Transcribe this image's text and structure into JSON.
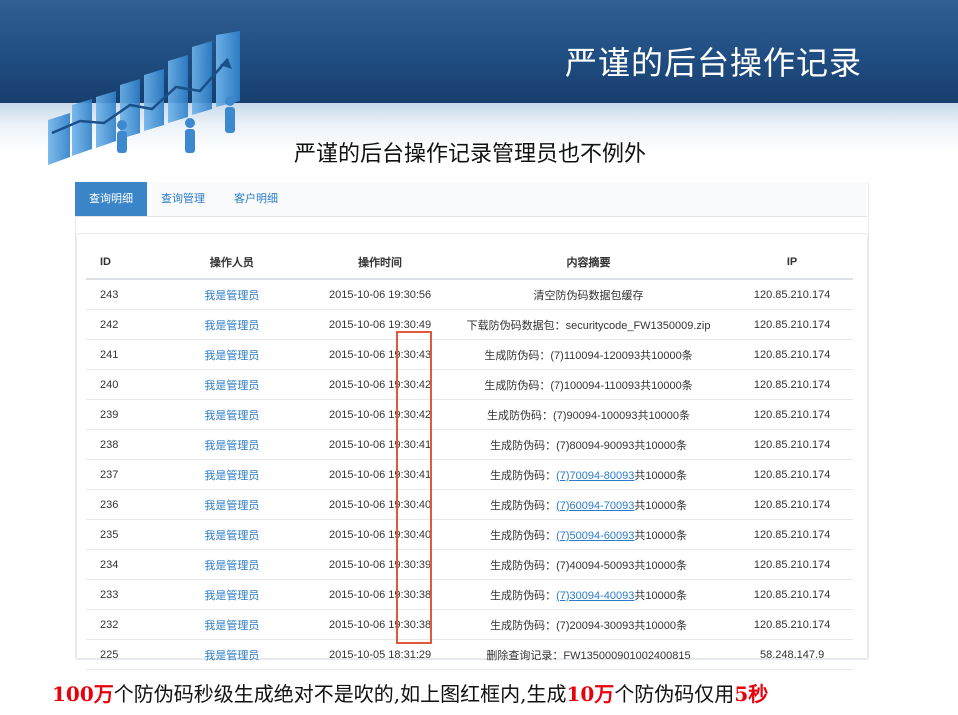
{
  "header": {
    "title": "严谨的后台操作记录"
  },
  "subtitle": "严谨的后台操作记录管理员也不例外",
  "tabs": [
    {
      "label": "查询明细",
      "active": true
    },
    {
      "label": "查询管理",
      "active": false
    },
    {
      "label": "客户明细",
      "active": false
    }
  ],
  "table": {
    "columns": [
      "ID",
      "操作人员",
      "操作时间",
      "内容摘要",
      "IP"
    ],
    "rows": [
      {
        "id": "243",
        "operator": "我是管理员",
        "time": "2015-10-06 19:30:56",
        "summary": "清空防伪码数据包缓存",
        "ip": "120.85.210.174"
      },
      {
        "id": "242",
        "operator": "我是管理员",
        "time": "2015-10-06 19:30:49",
        "summary": "下载防伪码数据包：securitycode_FW1350009.zip",
        "ip": "120.85.210.174"
      },
      {
        "id": "241",
        "operator": "我是管理员",
        "time": "2015-10-06 19:30:43",
        "summary": "生成防伪码：(7)110094-120093共10000条",
        "ip": "120.85.210.174"
      },
      {
        "id": "240",
        "operator": "我是管理员",
        "time": "2015-10-06 19:30:42",
        "summary": "生成防伪码：(7)100094-110093共10000条",
        "ip": "120.85.210.174"
      },
      {
        "id": "239",
        "operator": "我是管理员",
        "time": "2015-10-06 19:30:42",
        "summary": "生成防伪码：(7)90094-100093共10000条",
        "ip": "120.85.210.174"
      },
      {
        "id": "238",
        "operator": "我是管理员",
        "time": "2015-10-06 19:30:41",
        "summary": "生成防伪码：(7)80094-90093共10000条",
        "ip": "120.85.210.174"
      },
      {
        "id": "237",
        "operator": "我是管理员",
        "time": "2015-10-06 19:30:41",
        "summary_prefix": "生成防伪码：",
        "summary_link": "(7)70094-80093",
        "summary_suffix": "共10000条",
        "ip": "120.85.210.174"
      },
      {
        "id": "236",
        "operator": "我是管理员",
        "time": "2015-10-06 19:30:40",
        "summary_prefix": "生成防伪码：",
        "summary_link": "(7)60094-70093",
        "summary_suffix": "共10000条",
        "ip": "120.85.210.174"
      },
      {
        "id": "235",
        "operator": "我是管理员",
        "time": "2015-10-06 19:30:40",
        "summary_prefix": "生成防伪码：",
        "summary_link": "(7)50094-60093",
        "summary_suffix": "共10000条",
        "ip": "120.85.210.174"
      },
      {
        "id": "234",
        "operator": "我是管理员",
        "time": "2015-10-06 19:30:39",
        "summary": "生成防伪码：(7)40094-50093共10000条",
        "ip": "120.85.210.174"
      },
      {
        "id": "233",
        "operator": "我是管理员",
        "time": "2015-10-06 19:30:38",
        "summary_prefix": "生成防伪码：",
        "summary_link": "(7)30094-40093",
        "summary_suffix": "共10000条",
        "ip": "120.85.210.174"
      },
      {
        "id": "232",
        "operator": "我是管理员",
        "time": "2015-10-06 19:30:38",
        "summary": "生成防伪码：(7)20094-30093共10000条",
        "ip": "120.85.210.174"
      },
      {
        "id": "225",
        "operator": "我是管理员",
        "time": "2015-10-05 18:31:29",
        "summary": "删除查询记录：FW135000901002400815",
        "ip": "58.248.147.9"
      }
    ]
  },
  "caption": {
    "parts": [
      {
        "text": "100万",
        "highlight": true
      },
      {
        "text": "个防伪码秒级生成绝对不是吹的,如上图红框内,生成",
        "highlight": false
      },
      {
        "text": "10万",
        "highlight": true
      },
      {
        "text": "个防伪码仅用",
        "highlight": false
      },
      {
        "text": "5秒",
        "highlight": true
      }
    ]
  },
  "colors": {
    "banner": "#1f4c80",
    "accent": "#2b7bc8",
    "highlight": "#e8000b",
    "redbox": "#e05a3a"
  }
}
